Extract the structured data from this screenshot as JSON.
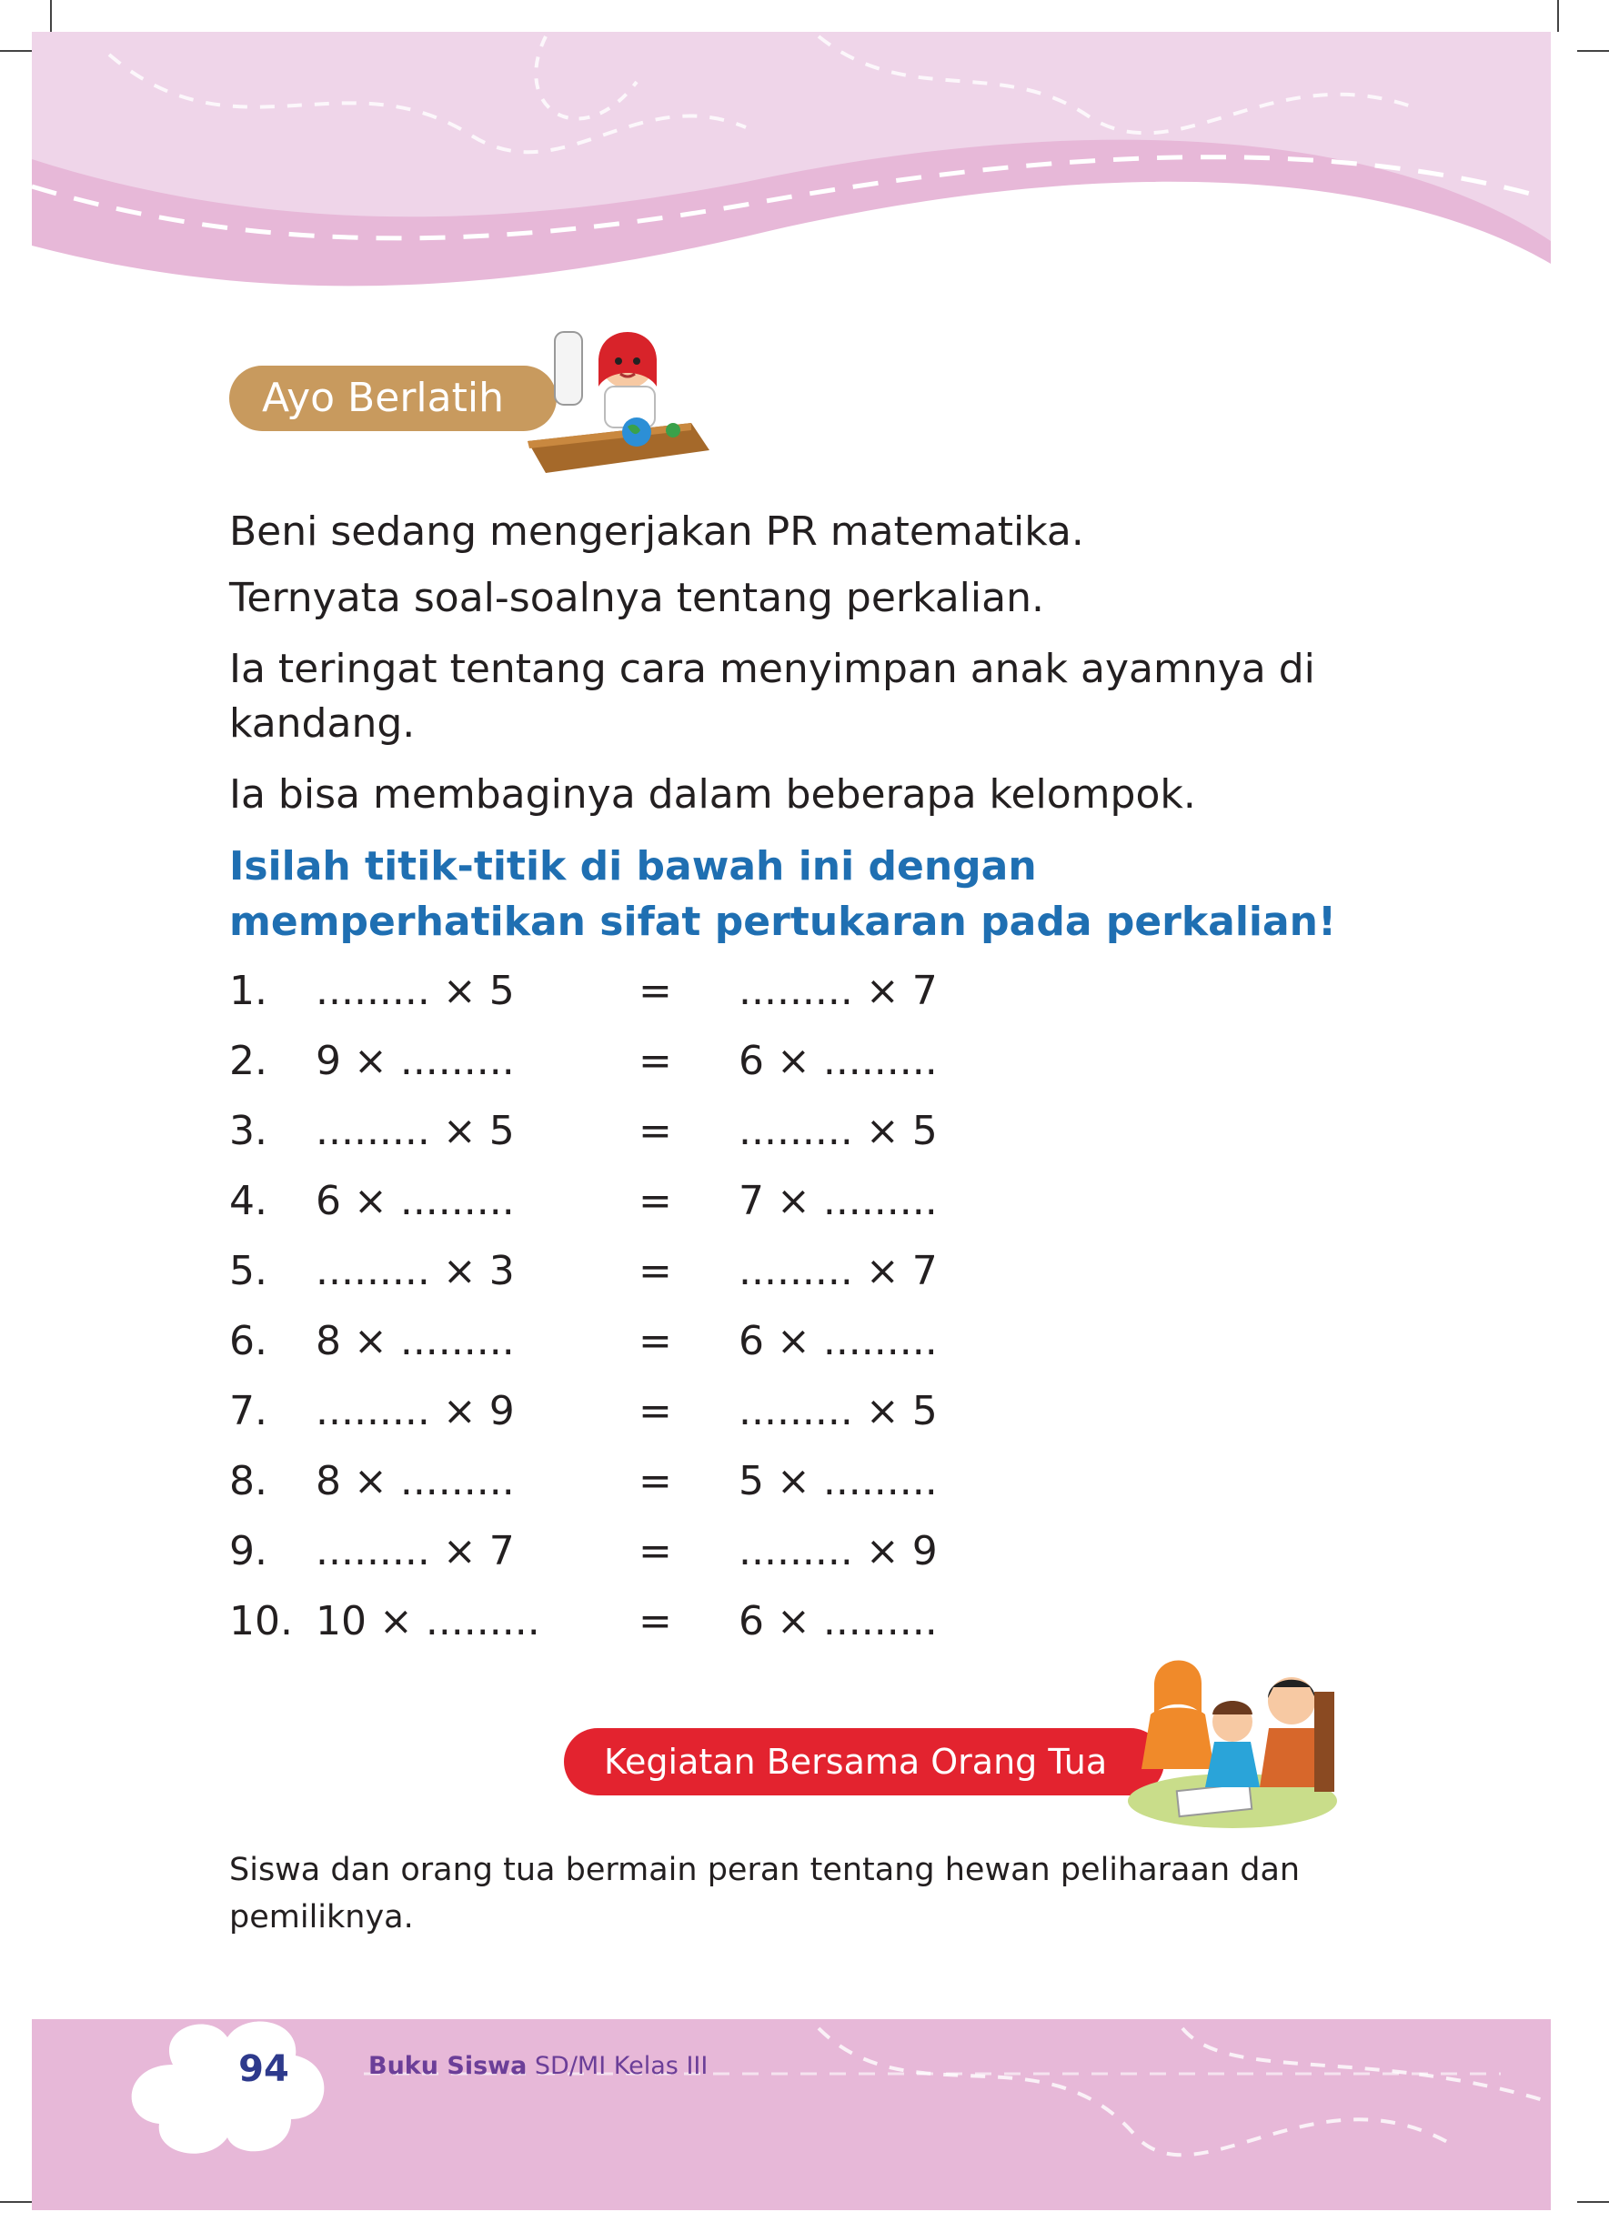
{
  "section_label": "Ayo Berlatih",
  "paragraphs": [
    "Beni sedang mengerjakan PR matematika.",
    "Ternyata soal-soalnya tentang perkalian.",
    "Ia teringat tentang cara menyimpan anak ayamnya di kandang.",
    "Ia bisa membaginya dalam beberapa kelompok."
  ],
  "instruction": [
    "Isilah titik-titik di bawah ini dengan",
    "memperhatikan sifat pertukaran pada perkalian!"
  ],
  "exercises": [
    {
      "num": "1.",
      "left": "......... × 5",
      "eq": "=",
      "right": "......... × 7"
    },
    {
      "num": "2.",
      "left": "9 × .........",
      "eq": "=",
      "right": "6 × ........."
    },
    {
      "num": "3.",
      "left": "......... × 5",
      "eq": "=",
      "right": "......... × 5"
    },
    {
      "num": "4.",
      "left": "6 × .........",
      "eq": "=",
      "right": "7 × ........."
    },
    {
      "num": "5.",
      "left": "......... × 3",
      "eq": "=",
      "right": "......... × 7"
    },
    {
      "num": "6.",
      "left": "8 × .........",
      "eq": "=",
      "right": "6 × ........."
    },
    {
      "num": "7.",
      "left": "......... × 9",
      "eq": "=",
      "right": "......... × 5"
    },
    {
      "num": "8.",
      "left": "8 × .........",
      "eq": "=",
      "right": "5 × ........."
    },
    {
      "num": "9.",
      "left": "......... × 7",
      "eq": "=",
      "right": "......... × 9"
    },
    {
      "num": "10.",
      "left": "10 × .........",
      "eq": "=",
      "right": "6 × ........."
    }
  ],
  "activity_label": "Kegiatan Bersama Orang Tua",
  "activity_text": "Siswa dan orang tua bermain peran tentang hewan peliharaan dan pemiliknya.",
  "footer": {
    "page_number": "94",
    "book_bold": "Buku Siswa",
    "book_rest": " SD/MI Kelas III"
  },
  "colors": {
    "header_pink": "#e7b8d8",
    "label_tan": "#c89a5e",
    "instruction_blue": "#1f6fb2",
    "activity_red": "#e3232f",
    "footer_purple": "#6b3e98"
  }
}
